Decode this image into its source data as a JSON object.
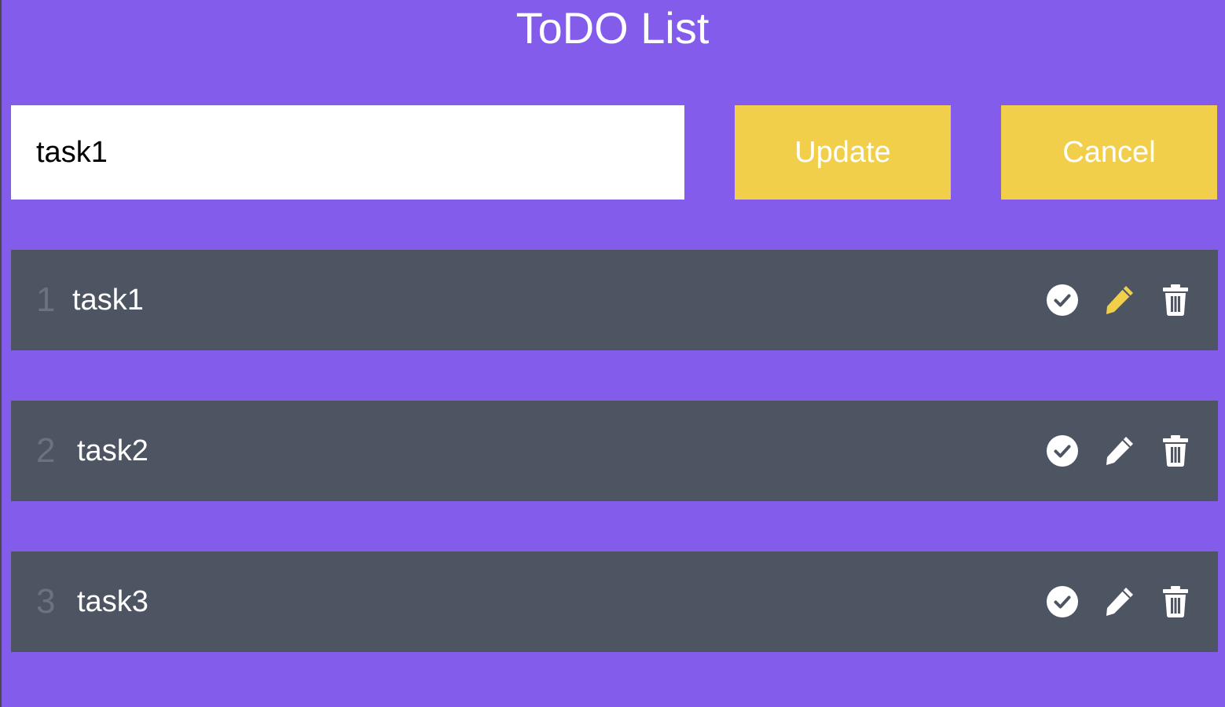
{
  "app": {
    "title": "ToDO List"
  },
  "editor": {
    "input_value": "task1",
    "update_label": "Update",
    "cancel_label": "Cancel"
  },
  "tasks": [
    {
      "number": "1",
      "text": "task1",
      "editing": true
    },
    {
      "number": "2",
      "text": "task2",
      "editing": false
    },
    {
      "number": "3",
      "text": "task3",
      "editing": false
    }
  ],
  "icons": {
    "complete": "check-circle-icon",
    "edit": "pen-icon",
    "delete": "trash-icon"
  },
  "colors": {
    "background": "#835CEB",
    "accent": "#F2CF4A",
    "row": "#4E5562",
    "number": "#6B7280",
    "text": "#FFFFFF"
  }
}
